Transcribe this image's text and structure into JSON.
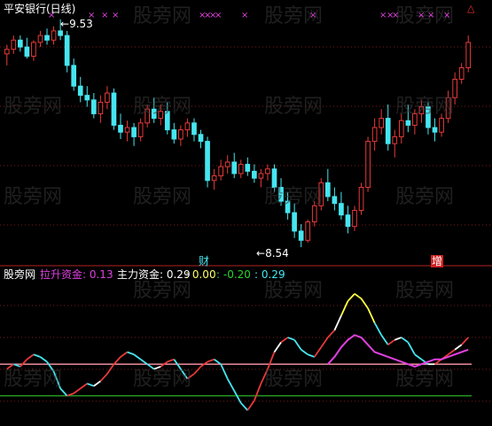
{
  "window_title": "平安银行(日线)",
  "watermark_text": "股旁网",
  "colors": {
    "up": "#e83a3a",
    "down": "#46e6f0",
    "grid": "#7f1a1a",
    "axis": "#b22222",
    "white_line": "#ffffff",
    "magenta": "#e040e0",
    "yellow": "#ffff44",
    "green_line": "#2bb52b",
    "pink_line": "#ff9aa8"
  },
  "price_panel": {
    "high_label": "9.53",
    "low_label": "8.54",
    "marker_finance": "财",
    "marker_increase": "增",
    "cross_symbol": "×",
    "triangle_symbol": "△"
  },
  "indicator_panel": {
    "name": "股旁网",
    "lashen_label": "拉升资金: 0.13",
    "zhuli_label": "主力资金: 0.29",
    "v1": ": 0.00",
    "v2": ": -0.20",
    "v3": ": 0.29"
  },
  "chart_data": {
    "type": "candlestick",
    "high": 9.53,
    "low": 8.54,
    "ohlc": [
      [
        9.38,
        9.42,
        9.33,
        9.4
      ],
      [
        9.4,
        9.46,
        9.38,
        9.44
      ],
      [
        9.44,
        9.46,
        9.39,
        9.41
      ],
      [
        9.41,
        9.45,
        9.36,
        9.37
      ],
      [
        9.37,
        9.44,
        9.35,
        9.43
      ],
      [
        9.43,
        9.48,
        9.41,
        9.46
      ],
      [
        9.46,
        9.49,
        9.42,
        9.44
      ],
      [
        9.44,
        9.5,
        9.42,
        9.48
      ],
      [
        9.48,
        9.53,
        9.44,
        9.46
      ],
      [
        9.46,
        9.48,
        9.3,
        9.33
      ],
      [
        9.33,
        9.36,
        9.22,
        9.24
      ],
      [
        9.24,
        9.28,
        9.17,
        9.2
      ],
      [
        9.2,
        9.24,
        9.15,
        9.18
      ],
      [
        9.18,
        9.21,
        9.1,
        9.12
      ],
      [
        9.12,
        9.2,
        9.08,
        9.17
      ],
      [
        9.17,
        9.24,
        9.14,
        9.21
      ],
      [
        9.21,
        9.23,
        9.05,
        9.07
      ],
      [
        9.07,
        9.12,
        9.01,
        9.04
      ],
      [
        9.04,
        9.09,
        9.0,
        9.06
      ],
      [
        9.06,
        9.08,
        8.98,
        9.02
      ],
      [
        9.02,
        9.1,
        9.0,
        9.08
      ],
      [
        9.08,
        9.16,
        9.06,
        9.14
      ],
      [
        9.14,
        9.19,
        9.08,
        9.1
      ],
      [
        9.1,
        9.16,
        9.07,
        9.13
      ],
      [
        9.13,
        9.17,
        9.03,
        9.05
      ],
      [
        9.05,
        9.08,
        8.99,
        9.01
      ],
      [
        9.01,
        9.07,
        8.98,
        9.05
      ],
      [
        9.05,
        9.1,
        9.02,
        9.08
      ],
      [
        9.08,
        9.1,
        9.0,
        9.03
      ],
      [
        9.03,
        9.05,
        8.97,
        9.0
      ],
      [
        9.0,
        9.02,
        8.8,
        8.83
      ],
      [
        8.83,
        8.88,
        8.79,
        8.85
      ],
      [
        8.85,
        8.92,
        8.83,
        8.89
      ],
      [
        8.89,
        8.94,
        8.86,
        8.91
      ],
      [
        8.91,
        8.95,
        8.84,
        8.86
      ],
      [
        8.86,
        8.92,
        8.84,
        8.9
      ],
      [
        8.9,
        8.93,
        8.85,
        8.87
      ],
      [
        8.87,
        8.9,
        8.82,
        8.84
      ],
      [
        8.84,
        8.88,
        8.8,
        8.86
      ],
      [
        8.86,
        8.9,
        8.83,
        8.88
      ],
      [
        8.88,
        8.9,
        8.78,
        8.8
      ],
      [
        8.8,
        8.84,
        8.72,
        8.74
      ],
      [
        8.74,
        8.78,
        8.66,
        8.69
      ],
      [
        8.69,
        8.73,
        8.58,
        8.61
      ],
      [
        8.61,
        8.64,
        8.54,
        8.57
      ],
      [
        8.57,
        8.66,
        8.56,
        8.65
      ],
      [
        8.65,
        8.74,
        8.63,
        8.72
      ],
      [
        8.72,
        8.84,
        8.7,
        8.82
      ],
      [
        8.82,
        8.88,
        8.74,
        8.76
      ],
      [
        8.76,
        8.8,
        8.7,
        8.73
      ],
      [
        8.73,
        8.78,
        8.66,
        8.68
      ],
      [
        8.68,
        8.72,
        8.6,
        8.63
      ],
      [
        8.63,
        8.72,
        8.61,
        8.7
      ],
      [
        8.7,
        8.82,
        8.68,
        8.8
      ],
      [
        8.8,
        9.02,
        8.78,
        9.0
      ],
      [
        9.0,
        9.1,
        8.96,
        9.06
      ],
      [
        9.06,
        9.14,
        9.03,
        9.1
      ],
      [
        9.1,
        9.16,
        8.96,
        8.99
      ],
      [
        8.99,
        9.05,
        8.93,
        9.02
      ],
      [
        9.02,
        9.12,
        8.99,
        9.09
      ],
      [
        9.09,
        9.16,
        9.04,
        9.07
      ],
      [
        9.07,
        9.14,
        9.03,
        9.12
      ],
      [
        9.12,
        9.18,
        9.08,
        9.15
      ],
      [
        9.15,
        9.17,
        9.03,
        9.06
      ],
      [
        9.06,
        9.1,
        9.0,
        9.04
      ],
      [
        9.04,
        9.12,
        9.02,
        9.1
      ],
      [
        9.1,
        9.22,
        9.08,
        9.19
      ],
      [
        9.19,
        9.3,
        9.16,
        9.27
      ],
      [
        9.27,
        9.34,
        9.25,
        9.32
      ],
      [
        9.32,
        9.46,
        9.3,
        9.43
      ]
    ],
    "indicator": {
      "white_zhuli": [
        -0.02,
        0.0,
        -0.01,
        0.02,
        0.04,
        0.03,
        0.01,
        -0.03,
        -0.1,
        -0.13,
        -0.12,
        -0.1,
        -0.08,
        -0.09,
        -0.07,
        -0.04,
        0.0,
        0.03,
        0.05,
        0.04,
        0.02,
        0.0,
        -0.02,
        -0.01,
        0.01,
        0.02,
        -0.02,
        -0.06,
        -0.04,
        -0.01,
        0.01,
        0.02,
        0.0,
        -0.06,
        -0.11,
        -0.16,
        -0.19,
        -0.15,
        -0.08,
        -0.02,
        0.05,
        0.09,
        0.11,
        0.1,
        0.06,
        0.04,
        0.03,
        0.07,
        0.11,
        0.14,
        0.2,
        0.26,
        0.29,
        0.27,
        0.23,
        0.17,
        0.12,
        0.08,
        0.1,
        0.11,
        0.09,
        0.04,
        0.02,
        0.0,
        0.0,
        0.02,
        0.04,
        0.06,
        0.08,
        0.11
      ],
      "magenta_lashen": [
        null,
        null,
        null,
        null,
        null,
        null,
        null,
        null,
        null,
        null,
        null,
        null,
        null,
        null,
        null,
        null,
        null,
        null,
        null,
        null,
        null,
        null,
        null,
        null,
        null,
        null,
        null,
        null,
        null,
        null,
        null,
        null,
        null,
        null,
        null,
        null,
        null,
        null,
        null,
        null,
        null,
        null,
        null,
        null,
        null,
        null,
        null,
        null,
        0.0,
        0.03,
        0.07,
        0.1,
        0.12,
        0.11,
        0.08,
        0.05,
        0.04,
        0.03,
        0.02,
        0.01,
        0.0,
        -0.01,
        0.0,
        0.01,
        0.02,
        0.02,
        0.03,
        0.04,
        0.05,
        0.06
      ],
      "pink_level": 0.0,
      "green_level": -0.13
    }
  }
}
